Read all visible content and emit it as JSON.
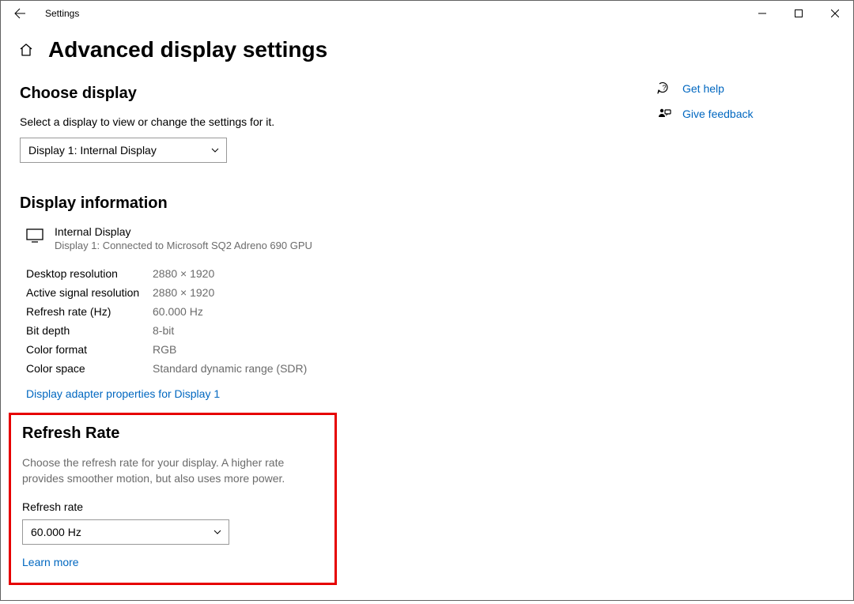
{
  "window": {
    "title": "Settings"
  },
  "page": {
    "title": "Advanced display settings"
  },
  "choose_display": {
    "heading": "Choose display",
    "instruction": "Select a display to view or change the settings for it.",
    "selected": "Display 1: Internal Display"
  },
  "display_info": {
    "heading": "Display information",
    "name": "Internal Display",
    "subtitle": "Display 1: Connected to Microsoft SQ2 Adreno 690 GPU",
    "rows": [
      {
        "k": "Desktop resolution",
        "v": "2880 × 1920"
      },
      {
        "k": "Active signal resolution",
        "v": "2880 × 1920"
      },
      {
        "k": "Refresh rate (Hz)",
        "v": "60.000 Hz"
      },
      {
        "k": "Bit depth",
        "v": "8-bit"
      },
      {
        "k": "Color format",
        "v": "RGB"
      },
      {
        "k": "Color space",
        "v": "Standard dynamic range (SDR)"
      }
    ],
    "adapter_link": "Display adapter properties for Display 1"
  },
  "refresh": {
    "heading": "Refresh Rate",
    "description": "Choose the refresh rate for your display. A higher rate provides smoother motion, but also uses more power.",
    "field_label": "Refresh rate",
    "selected": "60.000 Hz",
    "learn_more": "Learn more"
  },
  "help": {
    "get_help": "Get help",
    "give_feedback": "Give feedback"
  }
}
